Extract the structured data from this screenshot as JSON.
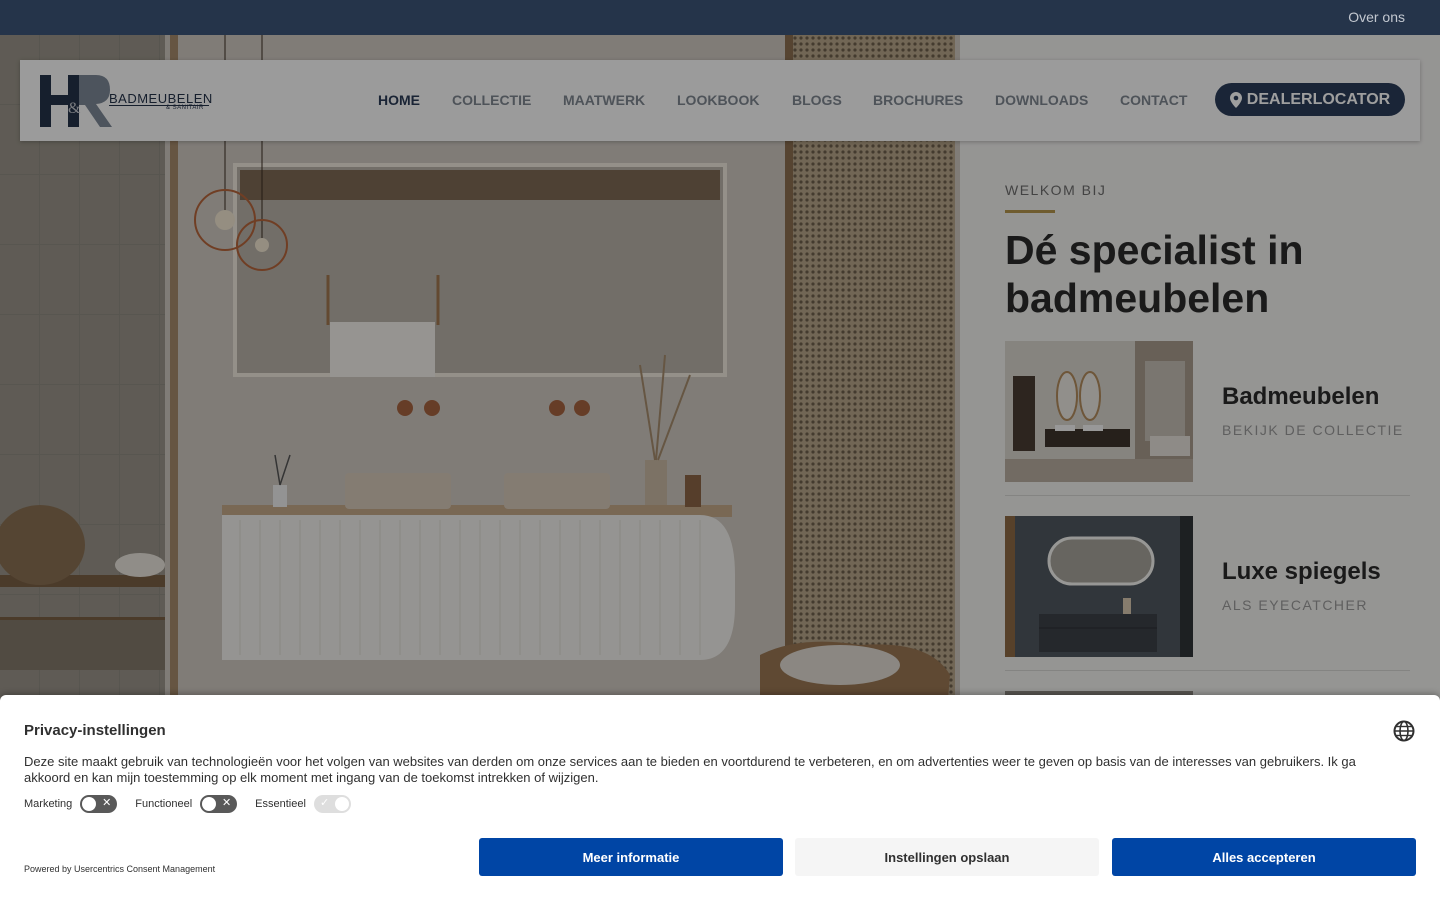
{
  "topbar": {
    "over_ons": "Over ons"
  },
  "logo": {
    "brand": "BADMEUBELEN",
    "sub": "& SANITAIR"
  },
  "nav": {
    "items": [
      "HOME",
      "COLLECTIE",
      "MAATWERK",
      "LOOKBOOK",
      "BLOGS",
      "BROCHURES",
      "DOWNLOADS",
      "CONTACT"
    ],
    "active": "HOME",
    "dealer": "DEALERLOCATOR",
    "dealer_icon": "map-marker-icon"
  },
  "intro": {
    "kicker": "WELKOM BIJ",
    "headline": "Dé specialist in badmeubelen"
  },
  "categories": [
    {
      "title": "Badmeubelen",
      "subtitle": "BEKIJK DE COLLECTIE"
    },
    {
      "title": "Luxe spiegels",
      "subtitle": "ALS EYECATCHER"
    }
  ],
  "consent": {
    "title": "Privacy-instellingen",
    "text": "Deze site maakt gebruik van technologieën voor het volgen van websites van derden om onze services aan te bieden en voortdurend te verbeteren, en om advertenties weer te geven op basis van de interesses van gebruikers. Ik ga akkoord en kan mijn toestemming op elk moment met ingang van de toekomst intrekken of wijzigen.",
    "toggles": [
      {
        "label": "Marketing",
        "enabled": false
      },
      {
        "label": "Functioneel",
        "enabled": false
      },
      {
        "label": "Essentieel",
        "enabled": true,
        "locked": true
      }
    ],
    "powered_by": "Powered by Usercentrics Consent Management",
    "buttons": {
      "more_info": "Meer informatie",
      "save": "Instellingen opslaan",
      "accept_all": "Alles accepteren"
    },
    "colors": {
      "primary": "#0045a5",
      "secondary": "#f5f5f5"
    }
  },
  "colors": {
    "navy": "#25344a",
    "accent_gold": "#b4954c"
  }
}
